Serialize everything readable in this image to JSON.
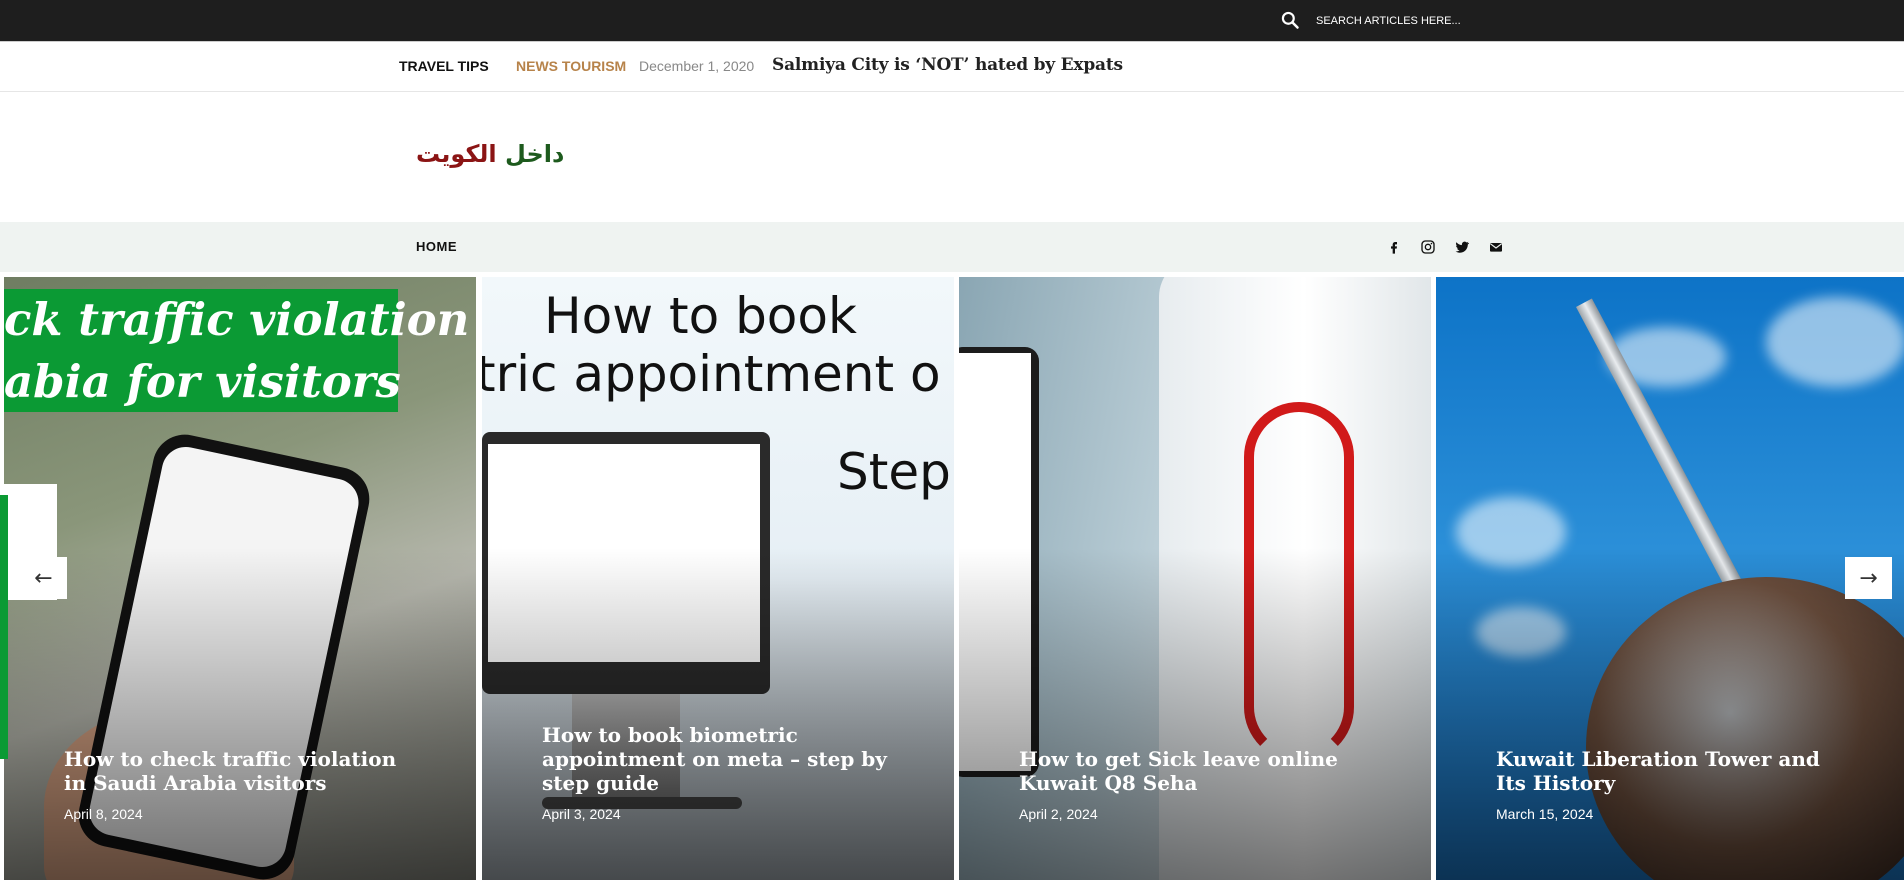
{
  "topbar": {
    "search_placeholder": "SEARCH ARTICLES HERE..."
  },
  "ticker": {
    "label": "TRAVEL TIPS",
    "category": "NEWS TOURISM",
    "date": "December 1, 2020",
    "title": "Salmiya City is ‘NOT’ hated by Expats"
  },
  "logo": {
    "part1": "داخل",
    "part2": "الكويت"
  },
  "nav": {
    "home_label": "HOME"
  },
  "socials": [
    "facebook-icon",
    "instagram-icon",
    "twitter-icon",
    "mail-icon"
  ],
  "slider": {
    "prev_label": "←",
    "next_label": "→",
    "slides": [
      {
        "title": "How to check traffic violation in Saudi Arabia visitors",
        "date": "April 8, 2024",
        "banner_line1": "ck traffic violation",
        "banner_line2": "abia for visitors"
      },
      {
        "title": "How to book biometric appointment on meta – step by step guide",
        "date": "April 3, 2024",
        "image_line1": "How to book",
        "image_line2": "tric appointment o",
        "image_line3": "Step"
      },
      {
        "title": "How to get Sick leave online Kuwait Q8 Seha",
        "date": "April 2, 2024"
      },
      {
        "title": "Kuwait Liberation Tower and Its History",
        "date": "March 15, 2024"
      }
    ]
  },
  "colors": {
    "topbar_bg": "#1e1e1e",
    "category_accent": "#b7834a",
    "logo_green": "#1d5a1d",
    "logo_red": "#8b1414",
    "nav_bg": "#eff3f1",
    "banner_green": "#0b9a34"
  }
}
